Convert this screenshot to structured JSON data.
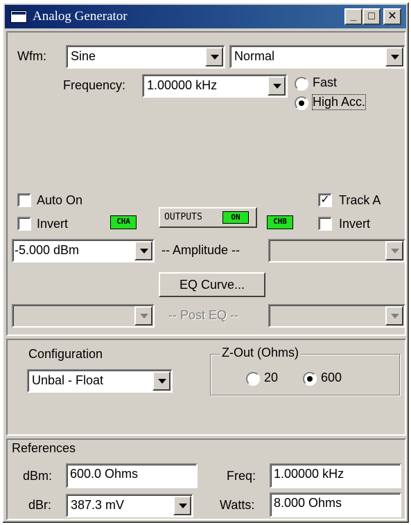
{
  "window": {
    "title": "Analog Generator"
  },
  "caption_buttons": {
    "minimize": "_",
    "maximize": "□",
    "close": "✕"
  },
  "top": {
    "wfm_label": "Wfm:",
    "wfm_value": "Sine",
    "mode_value": "Normal",
    "frequency_label": "Frequency:",
    "frequency_value": "1.00000 kHz",
    "fast_label": "Fast",
    "high_acc_label": "High Acc.",
    "selected_mode": "High Acc."
  },
  "outputs": {
    "auto_on_label": "Auto On",
    "auto_on_checked": false,
    "invert_a_label": "Invert",
    "invert_a_checked": false,
    "cha_badge": "CHA",
    "outputs_label": "OUTPUTS",
    "outputs_state": "ON",
    "chb_badge": "CHB",
    "track_a_label": "Track A",
    "track_a_checked": true,
    "invert_b_label": "Invert",
    "invert_b_checked": false,
    "amplitude_a": "-5.000  dBm",
    "amplitude_label": "-- Amplitude --",
    "amplitude_b": "",
    "eq_curve_button": "EQ Curve...",
    "post_eq_label": "-- Post EQ --",
    "post_eq_a": "",
    "post_eq_b": ""
  },
  "configuration": {
    "label": "Configuration",
    "value": "Unbal - Float",
    "zout_label": "Z-Out (Ohms)",
    "zout_20": "20",
    "zout_600": "600",
    "zout_selected": "600"
  },
  "references": {
    "title": "References",
    "dbm_label": "dBm:",
    "dbm_value": "600.0    Ohms",
    "freq_label": "Freq:",
    "freq_value": "1.00000 kHz",
    "dbr_label": "dBr:",
    "dbr_value": "387.3   mV",
    "watts_label": "Watts:",
    "watts_value": "8.000    Ohms"
  },
  "colors": {
    "title_bar": "#0a246a",
    "face": "#d4d0c8",
    "on_badge": "#21e021"
  }
}
